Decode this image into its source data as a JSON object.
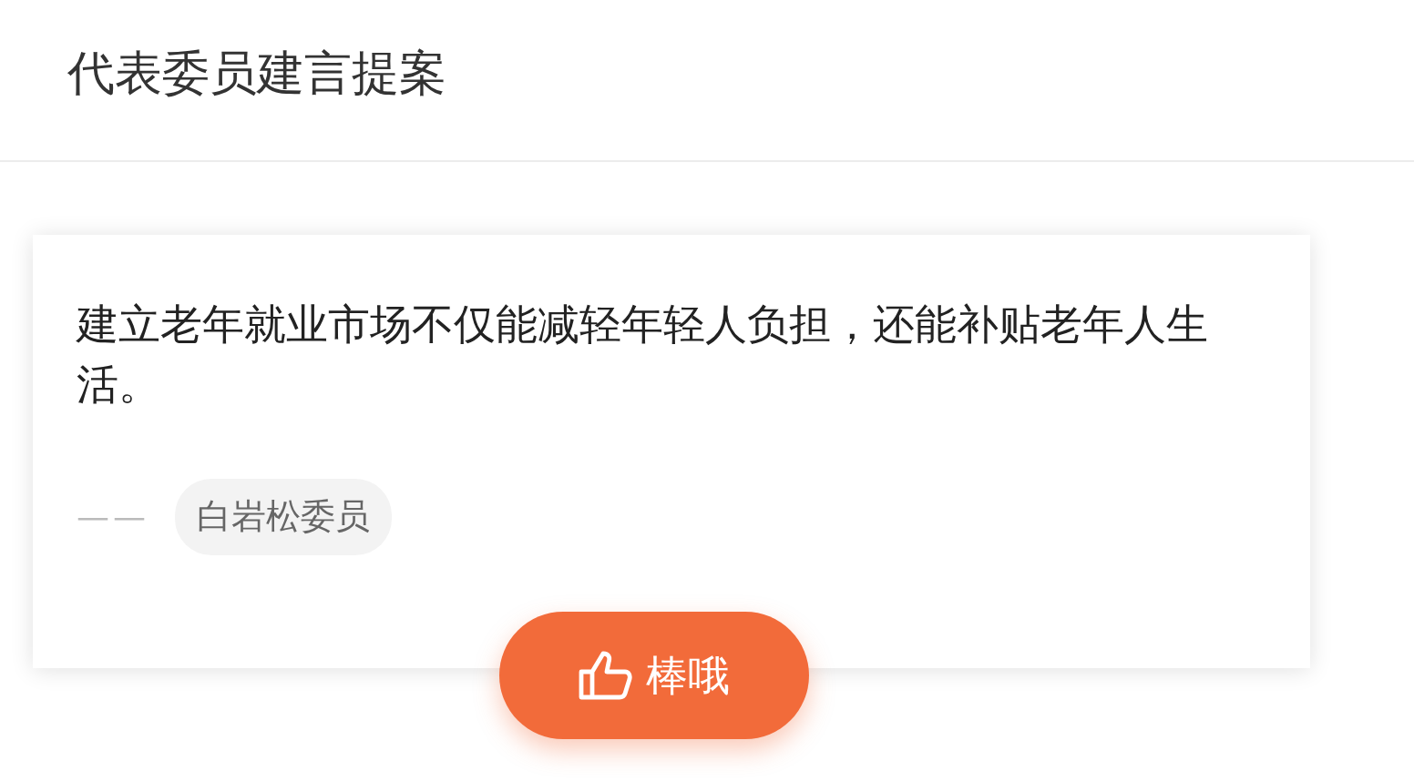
{
  "header": {
    "title": "代表委员建言提案"
  },
  "card": {
    "quote": "建立老年就业市场不仅能减轻年轻人负担，还能补贴老年人生活。",
    "dash": "——",
    "author": "白岩松委员"
  },
  "like_button": {
    "label": "棒哦"
  }
}
